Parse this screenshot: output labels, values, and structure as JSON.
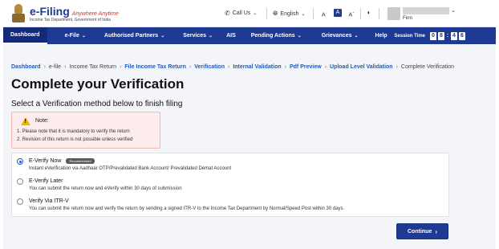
{
  "header": {
    "logo_title": "e-Filing",
    "logo_tagline": "Anywhere Anytime",
    "logo_subtitle": "Income Tax Department, Government of India",
    "call_us": "Call Us",
    "language": "English",
    "font_small": "A",
    "font_normal": "A",
    "font_large": "A",
    "user_role": "Firm"
  },
  "nav": {
    "items": [
      {
        "label": "Dashboard",
        "caret": false
      },
      {
        "label": "e-File",
        "caret": true
      },
      {
        "label": "Authorised Partners",
        "caret": true
      },
      {
        "label": "Services",
        "caret": true
      },
      {
        "label": "AIS",
        "caret": false
      },
      {
        "label": "Pending Actions",
        "caret": true
      },
      {
        "label": "Grievances",
        "caret": true
      },
      {
        "label": "Help",
        "caret": false
      }
    ],
    "session_label": "Session Time",
    "session_digits": [
      "0",
      "8",
      ":",
      "4",
      "6"
    ]
  },
  "breadcrumb": [
    {
      "label": "Dashboard",
      "link": true
    },
    {
      "label": "e-file",
      "link": false
    },
    {
      "label": "Income Tax Return",
      "link": false
    },
    {
      "label": "File Income Tax Return",
      "link": true
    },
    {
      "label": "Verification",
      "link": true
    },
    {
      "label": "Internal Validation",
      "link": true
    },
    {
      "label": "Pdf Preview",
      "link": true
    },
    {
      "label": "Upload Level Validation",
      "link": true
    },
    {
      "label": "Complete Verification",
      "link": false
    }
  ],
  "page": {
    "title": "Complete your Verification",
    "subtitle": "Select a Verification method below to finish filing"
  },
  "note": {
    "title": "Note:",
    "lines": [
      "1. Please note that it is mandatory to verify the return",
      "2. Revision of this return is not possible unless verified"
    ]
  },
  "options": [
    {
      "title": "E-Verify Now",
      "badge": "Recommended",
      "desc": "Instant eVerification via Aadhaar OTP/Prevalidated Bank Account/ Prevalidated Demat Account",
      "checked": true
    },
    {
      "title": "E-Verify Later",
      "badge": "",
      "desc": "You can submit the return now and eVerify within 30 days of submission",
      "checked": false
    },
    {
      "title": "Verify Via ITR-V",
      "badge": "",
      "desc": "You can submit the return now and verify the return by sending a signed ITR-V to the Income Tax Department by Normal/Speed Post within 30 days.",
      "checked": false
    }
  ],
  "continue_label": "Continue",
  "colors": {
    "nav_bg": "#1f3a93",
    "link": "#1f5bbf",
    "note_bg": "#fdecec"
  }
}
